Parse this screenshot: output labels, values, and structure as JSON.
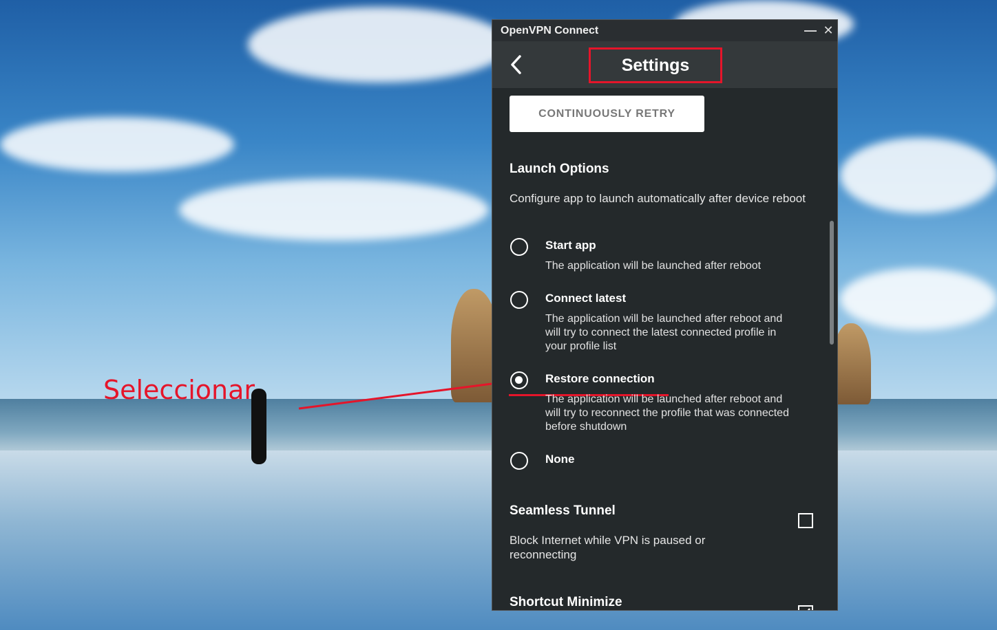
{
  "annotation": {
    "text": "Seleccionar",
    "color": "#e5152a"
  },
  "window": {
    "title": "OpenVPN Connect",
    "minimize_glyph": "—",
    "close_glyph": "✕"
  },
  "header": {
    "title": "Settings",
    "back_icon": "chevron-left-icon"
  },
  "retry_button": {
    "label": "CONTINUOUSLY RETRY"
  },
  "launch_options": {
    "title": "Launch Options",
    "description": "Configure app to launch automatically after device reboot",
    "selected": "Restore connection",
    "options": [
      {
        "label": "Start app",
        "description": "The application will be launched after reboot",
        "checked": false
      },
      {
        "label": "Connect latest",
        "description": "The application will be launched after reboot and will try to connect the latest connected profile in your profile list",
        "checked": false
      },
      {
        "label": "Restore connection",
        "description": "The application will be launched after reboot and will try to reconnect the profile that was connected before shutdown",
        "checked": true
      },
      {
        "label": "None",
        "description": "",
        "checked": false
      }
    ]
  },
  "seamless_tunnel": {
    "title": "Seamless Tunnel",
    "description": "Block Internet while VPN is paused or reconnecting",
    "checked": false
  },
  "shortcut_minimize": {
    "title": "Shortcut Minimize",
    "checked": true
  }
}
